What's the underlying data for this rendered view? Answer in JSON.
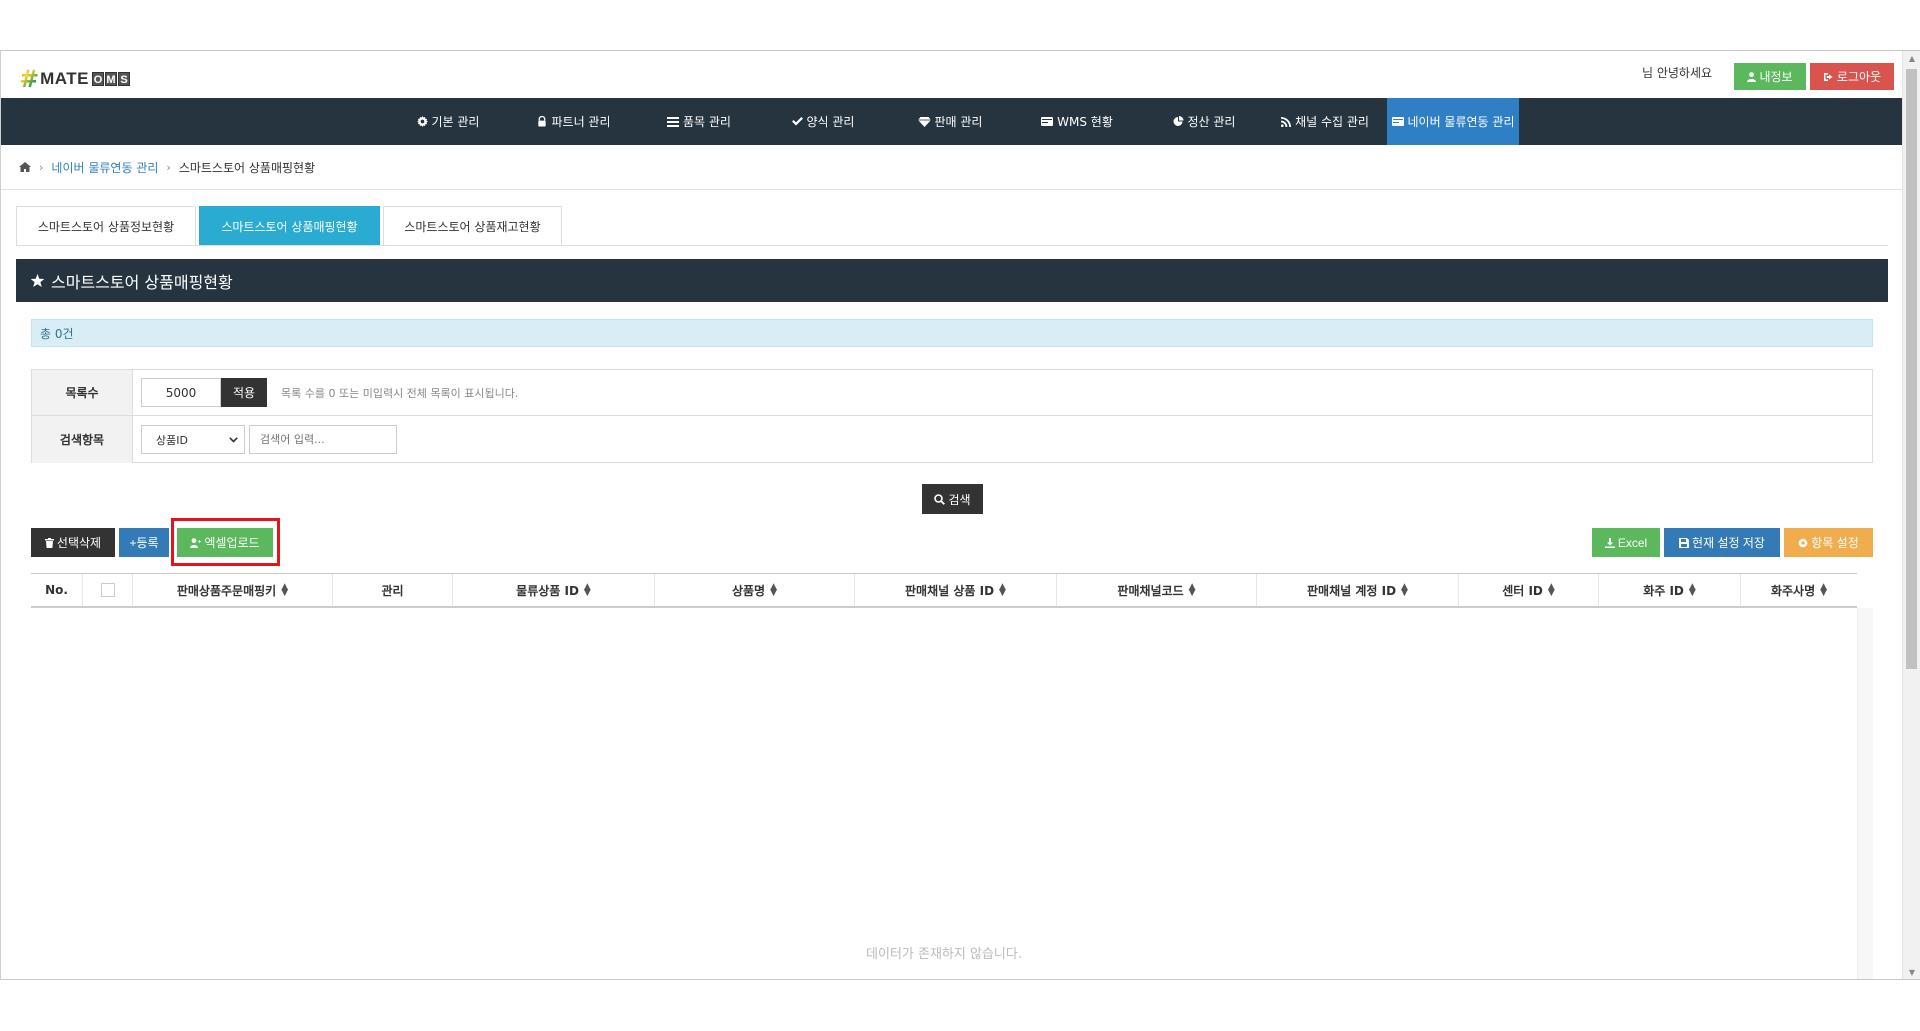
{
  "header": {
    "logo_mate": "MATE",
    "logo_oms": [
      "O",
      "M",
      "S"
    ],
    "greeting": "님 안녕하세요",
    "myinfo_label": "내정보",
    "logout_label": "로그아웃"
  },
  "nav": {
    "items": [
      {
        "label": "기본 관리",
        "icon": "gear-icon"
      },
      {
        "label": "파트너 관리",
        "icon": "lock-icon"
      },
      {
        "label": "품목 관리",
        "icon": "list-icon"
      },
      {
        "label": "양식 관리",
        "icon": "check-icon"
      },
      {
        "label": "판매 관리",
        "icon": "diamond-icon"
      },
      {
        "label": "WMS 현황",
        "icon": "card-icon"
      },
      {
        "label": "정산 관리",
        "icon": "pie-icon"
      },
      {
        "label": "채널 수집 관리",
        "icon": "rss-icon"
      },
      {
        "label": "네이버 물류연동 관리",
        "icon": "card-icon",
        "active": true
      }
    ]
  },
  "breadcrumb": {
    "home_icon": "home-icon",
    "parent": "네이버 물류연동 관리",
    "current": "스마트스토어 상품매핑현황"
  },
  "tabs": [
    {
      "label": "스마트스토어 상품정보현황"
    },
    {
      "label": "스마트스토어 상품매핑현황",
      "active": true
    },
    {
      "label": "스마트스토어 상품재고현황"
    }
  ],
  "panel": {
    "title": "스마트스토어 상품매핑현황",
    "total": "총 0건"
  },
  "search": {
    "list_count_label": "목록수",
    "list_count_value": "5000",
    "apply_label": "적용",
    "hint": "목록 수를 0 또는 미입력시 전체 목록이 표시됩니다.",
    "field_label": "검색항목",
    "field_selected": "상품ID",
    "keyword_placeholder": "검색어 입력...",
    "search_label": "검색"
  },
  "actions": {
    "delete_label": "선택삭제",
    "register_label": "+등록",
    "excel_upload_label": "엑셀업로드",
    "excel_label": "Excel",
    "save_settings_label": "현재 설정 저장",
    "column_settings_label": "항목 설정"
  },
  "colors": {
    "nav_bg": "#263440",
    "nav_active": "#2f7fc4",
    "tab_active": "#2aabd2",
    "green": "#5cb85c",
    "red": "#d9534f",
    "blue": "#337ab7",
    "orange": "#f0ad4e",
    "highlight": "#e5141b"
  },
  "grid": {
    "columns": [
      {
        "label": "No.",
        "sortable": false
      },
      {
        "label": "",
        "checkbox": true
      },
      {
        "label": "판매상품주문매핑키",
        "sortable": true
      },
      {
        "label": "관리",
        "sortable": false
      },
      {
        "label": "물류상품 ID",
        "sortable": true
      },
      {
        "label": "상품명",
        "sortable": true
      },
      {
        "label": "판매채널 상품 ID",
        "sortable": true
      },
      {
        "label": "판매채널코드",
        "sortable": true
      },
      {
        "label": "판매채널 계정 ID",
        "sortable": true
      },
      {
        "label": "센터 ID",
        "sortable": true
      },
      {
        "label": "화주 ID",
        "sortable": true
      },
      {
        "label": "화주사명",
        "sortable": true
      }
    ],
    "empty_message": "데이터가 존재하지 않습니다."
  }
}
